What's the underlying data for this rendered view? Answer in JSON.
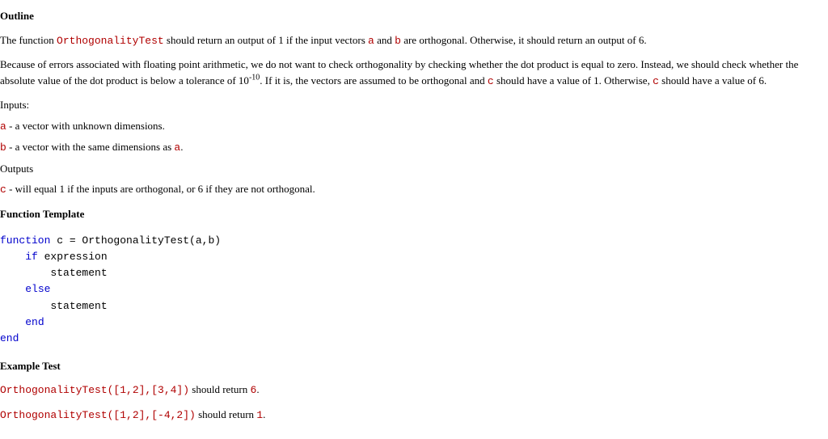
{
  "hdr_outline": "Outline",
  "intro": {
    "p1_a": "The function ",
    "p1_fn": "OrthogonalityTest",
    "p1_b": " should return an output of 1 if the input vectors ",
    "p1_va": "a",
    "p1_c": " and ",
    "p1_vb": "b",
    "p1_d": " are orthogonal. Otherwise, it should return an output of 6.",
    "p2_a": "Because of errors associated with floating point arithmetic, we do not want to check orthogonality by checking whether the dot product is equal to zero. Instead, we should check whether the absolute value of the dot product is below a tolerance of 10",
    "p2_exp": "-10",
    "p2_b": ". If it is, the vectors are assumed to be orthogonal and ",
    "p2_vc1": "c",
    "p2_c": " should have a value of 1. Otherwise, ",
    "p2_vc2": "c",
    "p2_d": " should have a value of 6."
  },
  "inputs": {
    "hdr": "Inputs:",
    "a_var": "a",
    "a_txt": " - a vector with unknown dimensions.",
    "b_var": "b",
    "b_txt": " - a vector with the same dimensions as ",
    "b_ref": "a",
    "b_end": "."
  },
  "outputs": {
    "hdr": "Outputs",
    "c_var": "c",
    "c_txt": " - will equal 1 if the inputs are orthogonal, or 6 if they are not orthogonal."
  },
  "hdr_template": "Function Template",
  "tmpl": {
    "l1_kw": "function ",
    "l1_rest": "c = OrthogonalityTest(a,b)",
    "l2_kw": "if ",
    "l2_rest": "expression",
    "l3": "statement",
    "l4_kw": "else",
    "l5": "statement",
    "l6_kw": "end",
    "l7_kw": "end"
  },
  "hdr_example": "Example Test",
  "ex1": {
    "call": "OrthogonalityTest([1,2],[3,4])",
    "txt": " should return ",
    "ret": "6",
    "end": "."
  },
  "ex2": {
    "call": "OrthogonalityTest([1,2],[-4,2])",
    "txt": " should return ",
    "ret": "1",
    "end": "."
  }
}
